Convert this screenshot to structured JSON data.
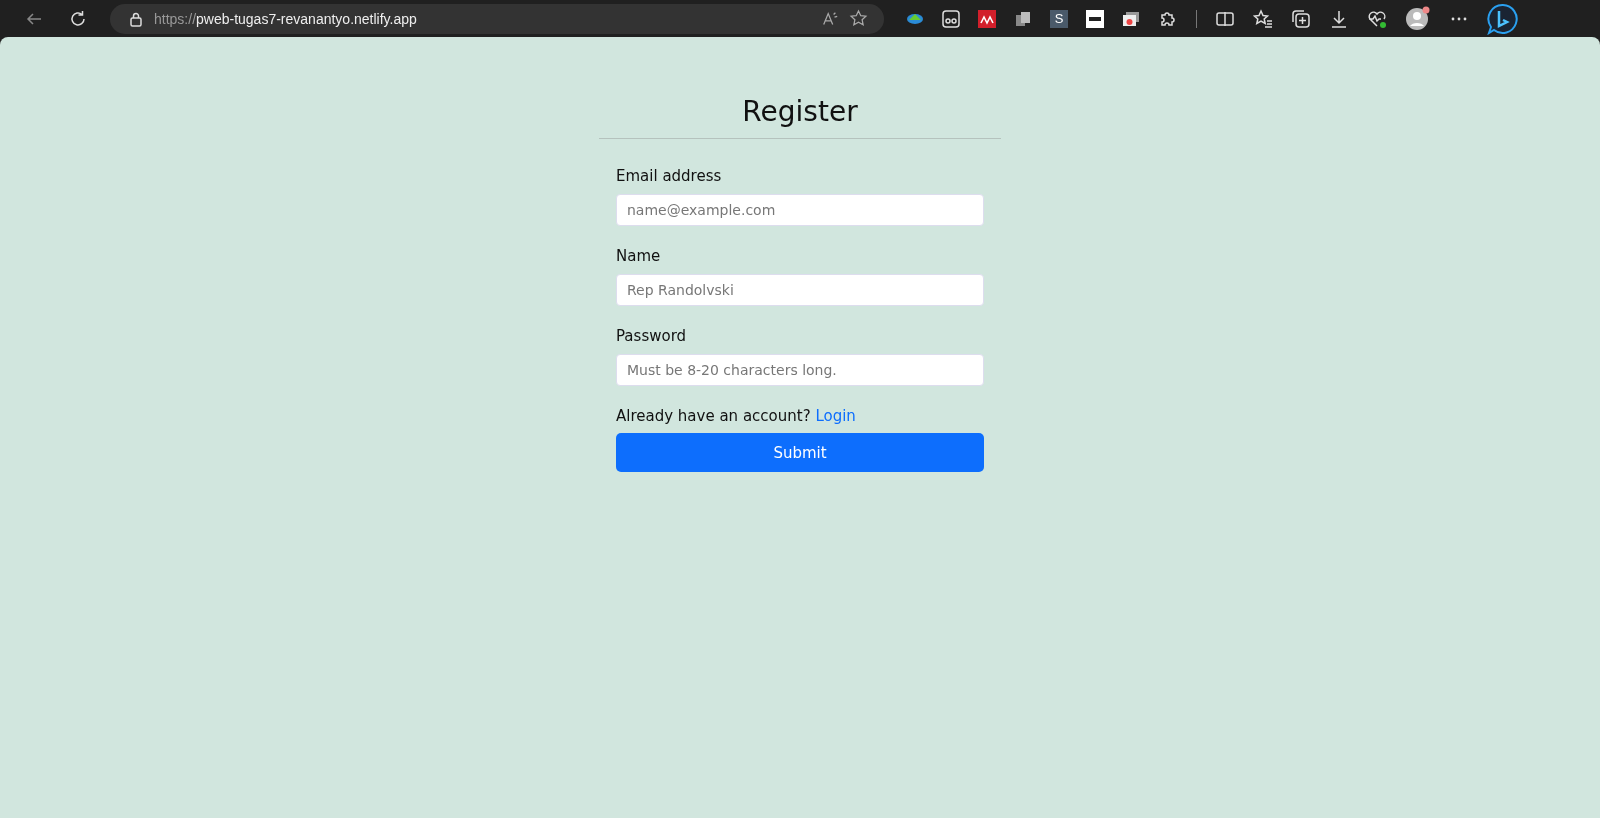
{
  "browser": {
    "url_scheme": "https://",
    "url_host": "pweb-tugas7-revanantyo.netlify.app",
    "extensions": [
      {
        "kind": "globe"
      },
      {
        "kind": "reader"
      },
      {
        "kind": "red"
      },
      {
        "kind": "copy"
      },
      {
        "kind": "letter",
        "label": "S"
      },
      {
        "kind": "white"
      },
      {
        "kind": "window"
      },
      {
        "kind": "puzzle"
      }
    ]
  },
  "form": {
    "title": "Register",
    "fields": [
      {
        "label": "Email address",
        "placeholder": "name@example.com"
      },
      {
        "label": "Name",
        "placeholder": "Rep Randolvski"
      },
      {
        "label": "Password",
        "placeholder": "Must be 8-20 characters long."
      }
    ],
    "prompt": "Already have an account?",
    "link": "Login",
    "submit": "Submit"
  }
}
